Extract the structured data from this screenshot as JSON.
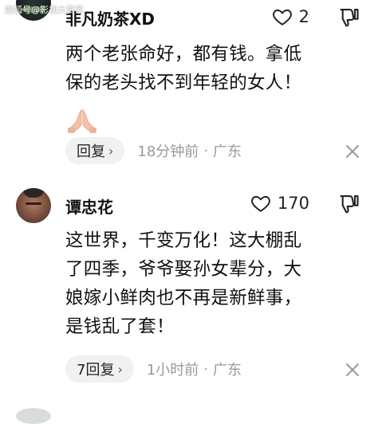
{
  "watermark": "搜狐号@影视大赏家",
  "comments": [
    {
      "username": "非凡奶茶XD",
      "likes": "2",
      "lines": [
        "两个老张命好，都有钱。拿低",
        "保的老头找不到年轻的女人！"
      ],
      "emoji": "pray-hands-emoji",
      "reply_label": "回复",
      "reply_arrow": "›",
      "time": "18分钟前",
      "separator": "·",
      "location": "广东"
    },
    {
      "username": "谭忠花",
      "likes": "170",
      "lines": [
        "这世界，千变万化！这大棚乱",
        "了四季，爷爷娶孙女辈分，大",
        "娘嫁小鲜肉也不再是新鲜事，",
        "是钱乱了套！"
      ],
      "reply_label": "7回复",
      "reply_arrow": "›",
      "time": "1小时前",
      "separator": "·",
      "location": "广东"
    }
  ],
  "icons": {
    "like": "heart-outline-icon",
    "dislike": "thumbs-down-icon",
    "close": "close-x-icon"
  },
  "colors": {
    "meta_text": "#9a9a9a",
    "reply_bg": "#f1f1f3",
    "emoji_skin": "#f2c2a4"
  }
}
